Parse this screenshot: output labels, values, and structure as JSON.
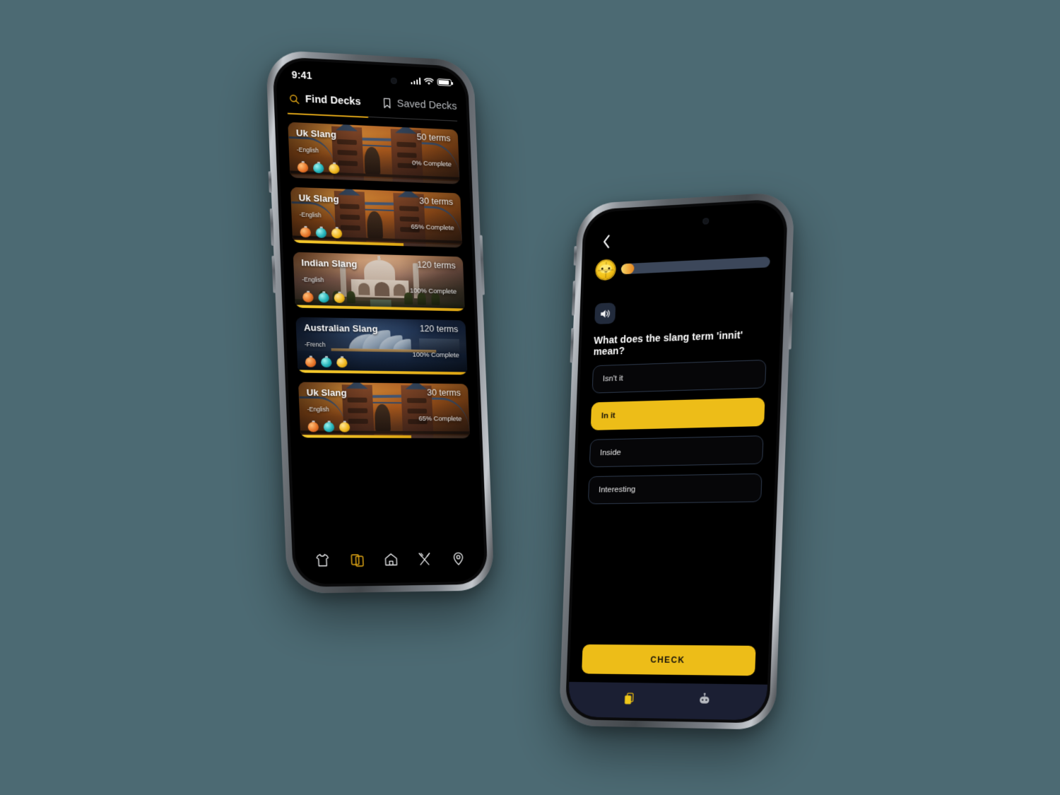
{
  "background_color": "#4c6a73",
  "accent_color": "#edbd18",
  "left_phone": {
    "status_bar": {
      "time": "9:41",
      "signal_icon": "cellular-signal-icon",
      "wifi_icon": "wifi-icon",
      "battery_icon": "battery-icon"
    },
    "tabs": [
      {
        "label": "Find Decks",
        "icon": "search-icon",
        "active": true
      },
      {
        "label": "Saved Decks",
        "icon": "bookmark-icon",
        "active": false
      }
    ],
    "decks": [
      {
        "title": "Uk Slang",
        "language": "-English",
        "terms": "50 terms",
        "completion_label": "0% Complete",
        "progress_percent": 0,
        "art": "london-tower-bridge"
      },
      {
        "title": "Uk Slang",
        "language": "-English",
        "terms": "30 terms",
        "completion_label": "65% Complete",
        "progress_percent": 65,
        "art": "london-tower-bridge"
      },
      {
        "title": "Indian Slang",
        "language": "-English",
        "terms": "120 terms",
        "completion_label": "100% Complete",
        "progress_percent": 100,
        "art": "taj-mahal"
      },
      {
        "title": "Australian Slang",
        "language": "-French",
        "terms": "120 terms",
        "completion_label": "100% Complete",
        "progress_percent": 100,
        "art": "sydney-opera-house"
      },
      {
        "title": "Uk Slang",
        "language": "-English",
        "terms": "30 terms",
        "completion_label": "65% Complete",
        "progress_percent": 65,
        "art": "london-tower-bridge"
      }
    ],
    "bottom_nav": [
      {
        "icon": "tshirt-icon",
        "active": false
      },
      {
        "icon": "cards-icon",
        "active": true
      },
      {
        "icon": "home-icon",
        "active": false
      },
      {
        "icon": "fork-knife-icon",
        "active": false
      },
      {
        "icon": "location-pin-icon",
        "active": false
      }
    ]
  },
  "right_phone": {
    "back_icon": "chevron-left-icon",
    "mascot_icon": "globe-mascot-icon",
    "lesson_progress_percent": 9,
    "speaker_icon": "speaker-icon",
    "question": "What does the slang term 'innit' mean?",
    "options": [
      {
        "label": "Isn't it",
        "selected": false
      },
      {
        "label": "In it",
        "selected": true
      },
      {
        "label": "Inside",
        "selected": false
      },
      {
        "label": "Interesting",
        "selected": false
      }
    ],
    "check_button_label": "CHECK",
    "bottom_nav": [
      {
        "icon": "flashcards-icon",
        "active": true
      },
      {
        "icon": "robot-icon",
        "active": false
      }
    ]
  }
}
